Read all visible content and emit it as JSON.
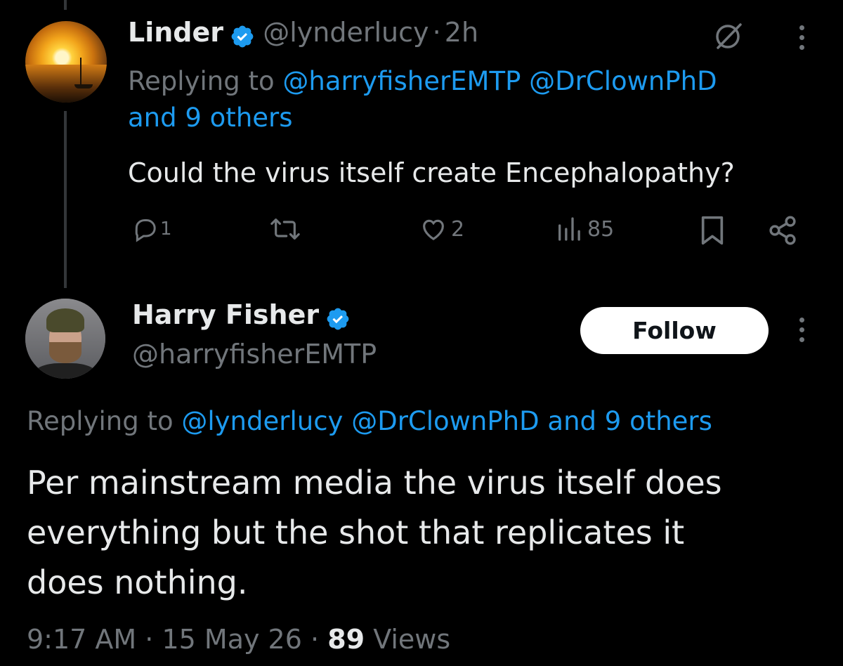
{
  "tweet1": {
    "author_name": "Linder",
    "handle": "@lynderlucy",
    "separator": "·",
    "time": "2h",
    "reply_prefix": "Replying to",
    "reply_mention_1": "@harryfisherEMTP",
    "reply_mention_2": "@DrClownPhD",
    "reply_others": "and 9 others",
    "text": "Could the virus itself create Encephalopathy?",
    "reply_count": "1",
    "like_count": "2",
    "view_count": "85",
    "icons": {
      "reply": "reply-icon",
      "retweet": "retweet-icon",
      "like": "heart-icon",
      "views": "views-chart-icon",
      "bookmark": "bookmark-icon",
      "share": "share-icon",
      "grok": "grok-icon",
      "more": "more-dots-icon"
    }
  },
  "tweet2": {
    "author_name": "Harry Fisher",
    "handle": "@harryfisherEMTP",
    "follow_label": "Follow",
    "reply_prefix": "Replying to",
    "reply_mention_1": "@lynderlucy",
    "reply_mention_2": "@DrClownPhD",
    "reply_others": "and 9 others",
    "text_line_1": "Per mainstream media the virus itself does",
    "text_line_2": "everything but the shot that replicates it",
    "text_line_3": "does nothing.",
    "time": "9:17 AM",
    "separator": "·",
    "date": "15 May 26",
    "view_count": "89",
    "views_label": "Views"
  },
  "colors": {
    "background": "#000000",
    "text": "#e7e9ea",
    "muted": "#71767b",
    "link": "#1d9bf0",
    "verified": "#1d9bf0",
    "follow_button_bg": "#ffffff"
  }
}
